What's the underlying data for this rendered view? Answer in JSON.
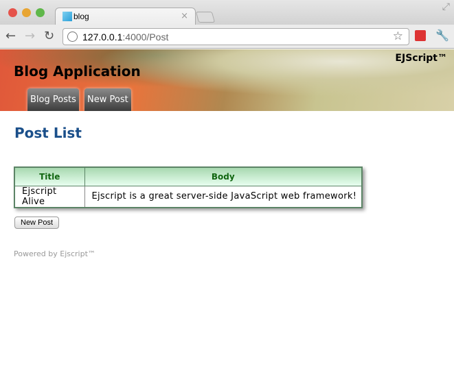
{
  "browser": {
    "tab_title": "blog",
    "url_host": "127.0.0.1",
    "url_rest": ":4000/Post",
    "close": "×",
    "back": "←",
    "forward": "→",
    "reload": "↻",
    "star": "☆",
    "wrench": "🔧"
  },
  "header": {
    "brand": "EJScript™",
    "title": "Blog Application",
    "nav": [
      {
        "label": "Blog Posts"
      },
      {
        "label": "New Post"
      }
    ]
  },
  "main": {
    "heading": "Post List",
    "table": {
      "columns": [
        "Title",
        "Body"
      ],
      "rows": [
        [
          "Ejscript Alive",
          "Ejscript is a great server-side JavaScript web framework!"
        ]
      ]
    },
    "new_post_button": "New Post"
  },
  "footer": {
    "text": "Powered by Ejscript™"
  },
  "colors": {
    "heading": "#1a4f8a",
    "table_header_text": "#116611",
    "table_border": "#5c8466"
  }
}
